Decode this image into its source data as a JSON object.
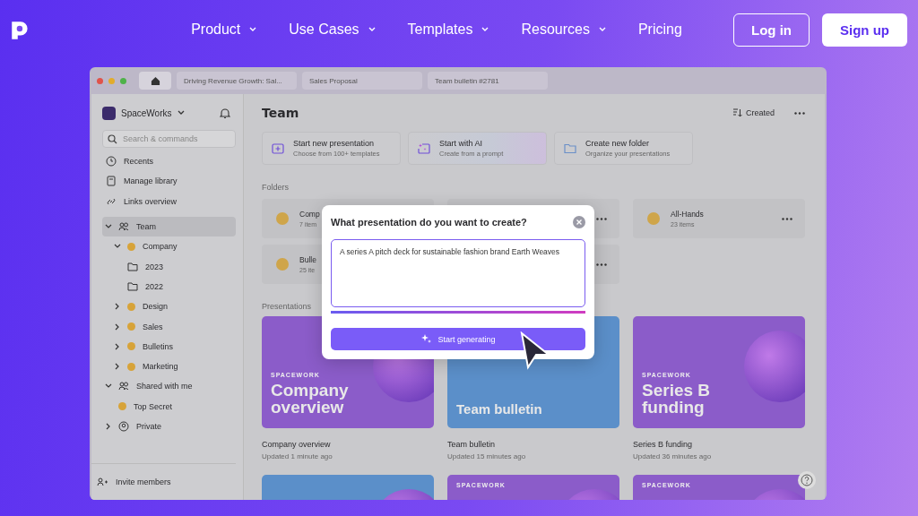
{
  "nav": {
    "links": [
      {
        "label": "Product",
        "dropdown": true
      },
      {
        "label": "Use Cases",
        "dropdown": true
      },
      {
        "label": "Templates",
        "dropdown": true
      },
      {
        "label": "Resources",
        "dropdown": true
      },
      {
        "label": "Pricing",
        "dropdown": false
      }
    ],
    "login": "Log in",
    "signup": "Sign up"
  },
  "app": {
    "tabs": [
      {
        "kind": "home",
        "selected": true
      },
      {
        "label": "Driving Revenue Growth: Sal...",
        "selected": false
      },
      {
        "label": "Sales Proposal",
        "selected": false
      },
      {
        "label": "Team bulletin #2781",
        "selected": false
      }
    ],
    "sidebar": {
      "workspace": "SpaceWorks",
      "search": {
        "placeholder": "Search & commands"
      },
      "links": [
        {
          "kind": "clock",
          "label": "Recents"
        },
        {
          "kind": "book",
          "label": "Manage library"
        },
        {
          "kind": "link",
          "label": "Links overview"
        }
      ],
      "tree": [
        {
          "kind": "team",
          "label": "Team",
          "expanded": true,
          "selected": true,
          "children": [
            {
              "kind": "emoji",
              "label": "Company",
              "expanded": true,
              "selected": false,
              "children": [
                {
                  "kind": "folder",
                  "label": "2023",
                  "selected": false
                },
                {
                  "kind": "folder",
                  "label": "2022",
                  "selected": false
                }
              ]
            },
            {
              "kind": "emoji",
              "label": "Design",
              "expanded": false,
              "selected": false
            },
            {
              "kind": "emoji",
              "label": "Sales",
              "expanded": false,
              "selected": false
            },
            {
              "kind": "emoji",
              "label": "Bulletins",
              "expanded": false,
              "selected": false
            },
            {
              "kind": "emoji",
              "label": "Marketing",
              "expanded": false,
              "selected": false
            }
          ]
        },
        {
          "kind": "team",
          "label": "Shared with me",
          "expanded": true,
          "selected": false,
          "children": [
            {
              "kind": "emoji",
              "label": "Top Secret",
              "selected": false
            }
          ]
        },
        {
          "kind": "person",
          "label": "Private",
          "expanded": false,
          "selected": false
        }
      ],
      "invite": "Invite members"
    },
    "title": "Team",
    "sort": "Created",
    "actions": [
      {
        "kind": "new",
        "title": "Start new presentation",
        "subtitle": "Choose from 100+ templates"
      },
      {
        "kind": "ai",
        "title": "Start with AI",
        "subtitle": "Create from a prompt"
      },
      {
        "kind": "folder",
        "title": "Create new folder",
        "subtitle": "Organize your presentations"
      }
    ],
    "folders_label": "Folders",
    "folders": [
      {
        "name": "Comp",
        "count": "7 item"
      },
      {
        "kind": "covered"
      },
      {
        "name": "All-Hands",
        "count": "23 items"
      },
      {
        "name": "Bulle",
        "count": "25 ite"
      },
      {
        "kind": "covered"
      }
    ],
    "presentations_label": "Presentations",
    "presentations": [
      {
        "color": "#8b5cc9",
        "brand": "SPACEWORK",
        "thumb_title": "Company overview",
        "name": "Company overview",
        "updated": "Updated 1 minute ago"
      },
      {
        "color": "#5b8fc9",
        "thumb_title": "Team bulletin",
        "name": "Team bulletin",
        "updated": "Updated 15 minutes ago"
      },
      {
        "color": "#8b5cc9",
        "brand": "SPACEWORK",
        "thumb_title": "Series B funding",
        "name": "Series B funding",
        "updated": "Updated 36 minutes ago"
      },
      {
        "color": "#5b8fc9"
      },
      {
        "color": "#8b5cc9",
        "brand": "SPACEWORK"
      },
      {
        "color": "#8b5cc9",
        "brand": "SPACEWORK"
      }
    ]
  },
  "dialog": {
    "title": "What presentation do you want to create?",
    "prompt": "A series A pitch deck for sustainable fashion brand Earth Weaves",
    "button": "Start generating"
  }
}
